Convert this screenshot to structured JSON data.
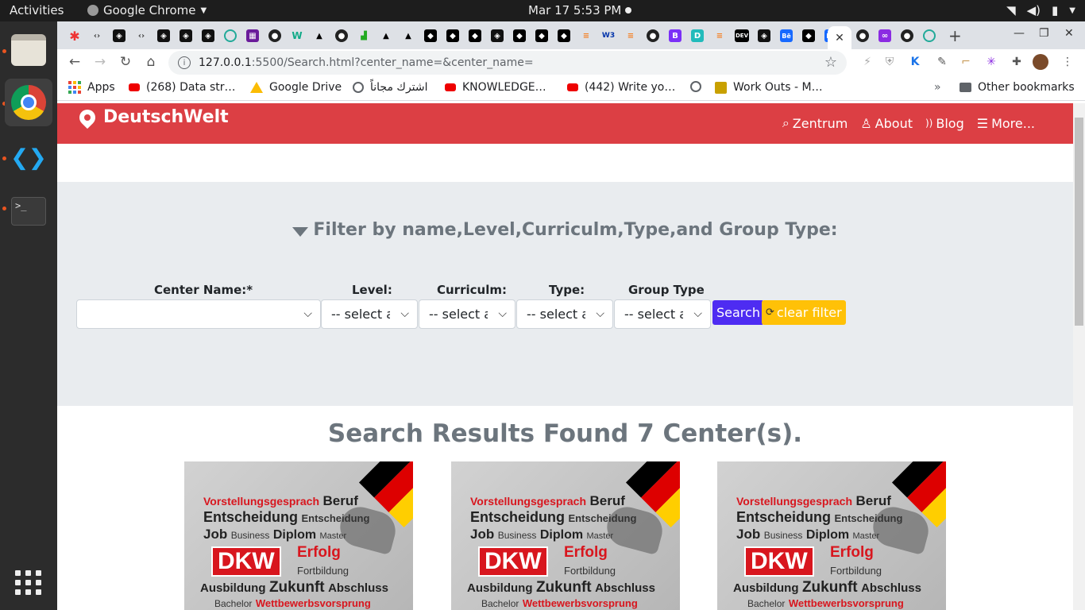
{
  "system": {
    "activities": "Activities",
    "app_name": "Google Chrome",
    "clock": "Mar 17  5:53 PM"
  },
  "browser": {
    "url_host": "127.0.0.1",
    "url_path": ":5500/Search.html?center_name=&center_name=",
    "bookmarks": [
      {
        "label": "Apps"
      },
      {
        "label": "(268) Data str…"
      },
      {
        "label": "Google Drive"
      },
      {
        "label": "اشترك مجاناً"
      },
      {
        "label": "KNOWLEDGE…"
      },
      {
        "label": "(442) Write yo…"
      },
      {
        "label": "Work Outs - M…"
      },
      {
        "label": "Other bookmarks"
      }
    ],
    "overflow": "»"
  },
  "page": {
    "brand": "DeutschWelt",
    "nav": [
      {
        "label": "Zentrum"
      },
      {
        "label": "About"
      },
      {
        "label": "Blog"
      },
      {
        "label": "More..."
      }
    ],
    "filter_title": "Filter by name,Level,Curriculm,Type,and Group Type:",
    "filters": [
      {
        "label": "Center Name:*",
        "value": ""
      },
      {
        "label": "Level:",
        "value": "-- select an"
      },
      {
        "label": "Curriculm:",
        "value": "-- select an"
      },
      {
        "label": "Type:",
        "value": "-- select an"
      },
      {
        "label": "Group Type",
        "value": "-- select an"
      }
    ],
    "search_button": "Search",
    "clear_button": "clear filter",
    "results_title": "Search Results Found 7 Center(s).",
    "card_lines": {
      "l1a": "Vorstellungsgesprach",
      "l1b": "Beruf",
      "l2a": "Entscheidung",
      "l2b": "Entscheidung",
      "l3a": "Job",
      "l3b": "Business",
      "l3c": "Diplom",
      "l3d": "Master",
      "dkw": "DKW",
      "erfolg": "Erfolg",
      "fort": "Fortbildung",
      "l5a": "Ausbildung",
      "l5b": "Zukunft",
      "l5c": "Abschluss",
      "l6a": "Bachelor",
      "l6b": "Wettbewerbsvorsprung"
    }
  },
  "colors": {
    "navbar": "#dc3f44",
    "search_btn": "#4e2cf2",
    "clear_btn": "#ffc107",
    "filter_bg": "#e9ecef"
  }
}
